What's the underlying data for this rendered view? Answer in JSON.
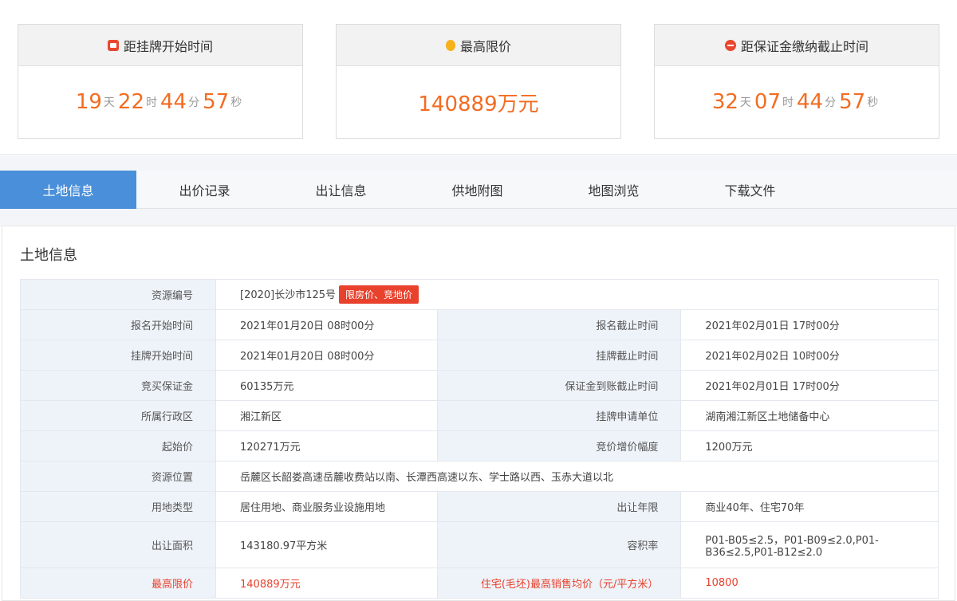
{
  "countdown": {
    "listing_start": {
      "title": "距挂牌开始时间",
      "days": "19",
      "hours": "22",
      "minutes": "44",
      "seconds": "57"
    },
    "max_price": {
      "title": "最高限价",
      "value": "140889万元"
    },
    "deposit_deadline": {
      "title": "距保证金缴纳截止时间",
      "days": "32",
      "hours": "07",
      "minutes": "44",
      "seconds": "57"
    },
    "units": {
      "day": "天",
      "hour": "时",
      "minute": "分",
      "second": "秒"
    }
  },
  "tabs": [
    "土地信息",
    "出价记录",
    "出让信息",
    "供地附图",
    "地图浏览",
    "下载文件"
  ],
  "section_title": "土地信息",
  "table": {
    "resource_no": {
      "label": "资源编号",
      "value": "[2020]长沙市125号",
      "tag": "限房价、竞地价"
    },
    "reg_start": {
      "label": "报名开始时间",
      "value": "2021年01月20日 08时00分"
    },
    "reg_end": {
      "label": "报名截止时间",
      "value": "2021年02月01日 17时00分"
    },
    "list_start": {
      "label": "挂牌开始时间",
      "value": "2021年01月20日 08时00分"
    },
    "list_end": {
      "label": "挂牌截止时间",
      "value": "2021年02月02日 10时00分"
    },
    "deposit": {
      "label": "竞买保证金",
      "value": "60135万元"
    },
    "deposit_deadline": {
      "label": "保证金到账截止时间",
      "value": "2021年02月01日 17时00分"
    },
    "district": {
      "label": "所属行政区",
      "value": "湘江新区"
    },
    "applicant_unit": {
      "label": "挂牌申请单位",
      "value": "湖南湘江新区土地储备中心"
    },
    "start_price": {
      "label": "起始价",
      "value": "120271万元"
    },
    "increment": {
      "label": "竞价增价幅度",
      "value": "1200万元"
    },
    "location": {
      "label": "资源位置",
      "value": "岳麓区长韶娄高速岳麓收费站以南、长潭西高速以东、学士路以西、玉赤大道以北"
    },
    "land_use": {
      "label": "用地类型",
      "value": "居住用地、商业服务业设施用地"
    },
    "term": {
      "label": "出让年限",
      "value": "商业40年、住宅70年"
    },
    "area": {
      "label": "出让面积",
      "value": "143180.97平方米"
    },
    "plot_ratio": {
      "label": "容积率",
      "value_line1": "P01-B05≤2.5，P01-B09≤2.0,P01-",
      "value_line2": "B36≤2.5,P01-B12≤2.0"
    },
    "max_price": {
      "label": "最高限价",
      "value": "140889万元"
    },
    "max_sale_price": {
      "label": "住宅(毛坯)最高销售均价（元/平方米）",
      "value": "10800"
    }
  }
}
